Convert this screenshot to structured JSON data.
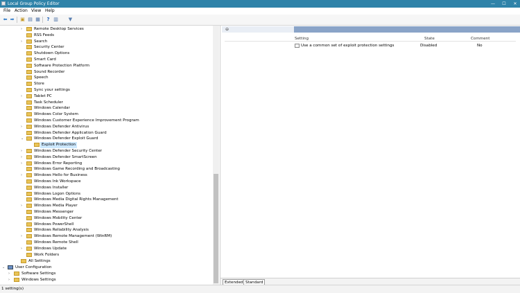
{
  "window": {
    "title": "Local Group Policy Editor",
    "controls": [
      "—",
      "☐",
      "✕"
    ]
  },
  "menu": [
    "File",
    "Action",
    "View",
    "Help"
  ],
  "toolbar": {
    "icons": [
      "back-arrow-icon",
      "forward-arrow-icon",
      "folder-up-icon",
      "show-hide-tree-icon",
      "export-list-icon",
      "help-icon",
      "properties-icon",
      "filter-icon"
    ]
  },
  "tree": {
    "items": [
      {
        "label": "Remote Desktop Services",
        "expandable": true
      },
      {
        "label": "RSS Feeds",
        "expandable": false
      },
      {
        "label": "Search",
        "expandable": true
      },
      {
        "label": "Security Center",
        "expandable": false
      },
      {
        "label": "Shutdown Options",
        "expandable": false
      },
      {
        "label": "Smart Card",
        "expandable": false
      },
      {
        "label": "Software Protection Platform",
        "expandable": false
      },
      {
        "label": "Sound Recorder",
        "expandable": false
      },
      {
        "label": "Speech",
        "expandable": false
      },
      {
        "label": "Store",
        "expandable": false
      },
      {
        "label": "Sync your settings",
        "expandable": false
      },
      {
        "label": "Tablet PC",
        "expandable": true
      },
      {
        "label": "Task Scheduler",
        "expandable": false
      },
      {
        "label": "Windows Calendar",
        "expandable": false
      },
      {
        "label": "Windows Color System",
        "expandable": false
      },
      {
        "label": "Windows Customer Experience Improvement Program",
        "expandable": false
      },
      {
        "label": "Windows Defender Antivirus",
        "expandable": true
      },
      {
        "label": "Windows Defender Application Guard",
        "expandable": false
      },
      {
        "label": "Windows Defender Exploit Guard",
        "expandable": true,
        "expanded": true
      },
      {
        "label": "Exploit Protection",
        "expandable": false,
        "child": true,
        "selected": true
      },
      {
        "label": "Windows Defender Security Center",
        "expandable": true
      },
      {
        "label": "Windows Defender SmartScreen",
        "expandable": true
      },
      {
        "label": "Windows Error Reporting",
        "expandable": true
      },
      {
        "label": "Windows Game Recording and Broadcasting",
        "expandable": false
      },
      {
        "label": "Windows Hello for Business",
        "expandable": true
      },
      {
        "label": "Windows Ink Workspace",
        "expandable": false
      },
      {
        "label": "Windows Installer",
        "expandable": false
      },
      {
        "label": "Windows Logon Options",
        "expandable": false
      },
      {
        "label": "Windows Media Digital Rights Management",
        "expandable": false
      },
      {
        "label": "Windows Media Player",
        "expandable": true
      },
      {
        "label": "Windows Messenger",
        "expandable": false
      },
      {
        "label": "Windows Mobility Center",
        "expandable": false
      },
      {
        "label": "Windows PowerShell",
        "expandable": false
      },
      {
        "label": "Windows Reliability Analysis",
        "expandable": false
      },
      {
        "label": "Windows Remote Management (WinRM)",
        "expandable": true
      },
      {
        "label": "Windows Remote Shell",
        "expandable": false
      },
      {
        "label": "Windows Update",
        "expandable": true
      },
      {
        "label": "Work Folders",
        "expandable": false
      }
    ],
    "all_settings": "All Settings",
    "user_configuration": "User Configuration",
    "software_settings": "Software Settings",
    "windows_settings": "Windows Settings"
  },
  "details": {
    "columns": {
      "setting": "Setting",
      "state": "State",
      "comment": "Comment"
    },
    "rows": [
      {
        "setting": "Use a common set of exploit protection settings",
        "state": "Disabled",
        "comment": "No"
      }
    ]
  },
  "tabs": [
    "Extended",
    "Standard"
  ],
  "status": "1 setting(s)"
}
